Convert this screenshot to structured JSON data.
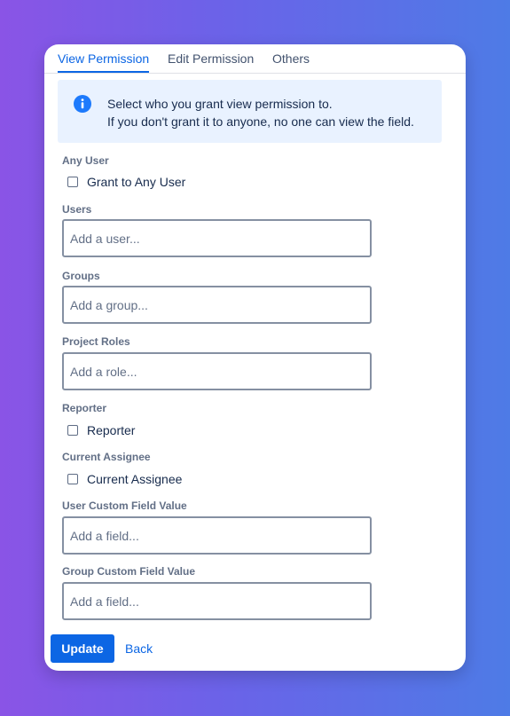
{
  "tabs": [
    {
      "label": "View Permission",
      "active": true
    },
    {
      "label": "Edit Permission",
      "active": false
    },
    {
      "label": "Others",
      "active": false
    }
  ],
  "info": {
    "icon": "info-icon",
    "line1": "Select who you grant view permission to.",
    "line2": "If you don't grant it to anyone, no one can view the field."
  },
  "sections": {
    "any_user": {
      "label": "Any User",
      "checkbox_label": "Grant to Any User",
      "checked": false
    },
    "users": {
      "label": "Users",
      "placeholder": "Add a user...",
      "value": ""
    },
    "groups": {
      "label": "Groups",
      "placeholder": "Add a group...",
      "value": ""
    },
    "project_roles": {
      "label": "Project Roles",
      "placeholder": "Add a role...",
      "value": ""
    },
    "reporter": {
      "label": "Reporter",
      "checkbox_label": "Reporter",
      "checked": false
    },
    "current_assignee": {
      "label": "Current Assignee",
      "checkbox_label": "Current Assignee",
      "checked": false
    },
    "user_custom_field": {
      "label": "User Custom Field Value",
      "placeholder": "Add a field...",
      "value": ""
    },
    "group_custom_field": {
      "label": "Group Custom Field Value",
      "placeholder": "Add a field...",
      "value": ""
    }
  },
  "actions": {
    "update_label": "Update",
    "back_label": "Back"
  },
  "colors": {
    "accent": "#0c66e4",
    "info_bg": "#e9f2ff",
    "label": "#626f86",
    "text": "#172b4d"
  }
}
